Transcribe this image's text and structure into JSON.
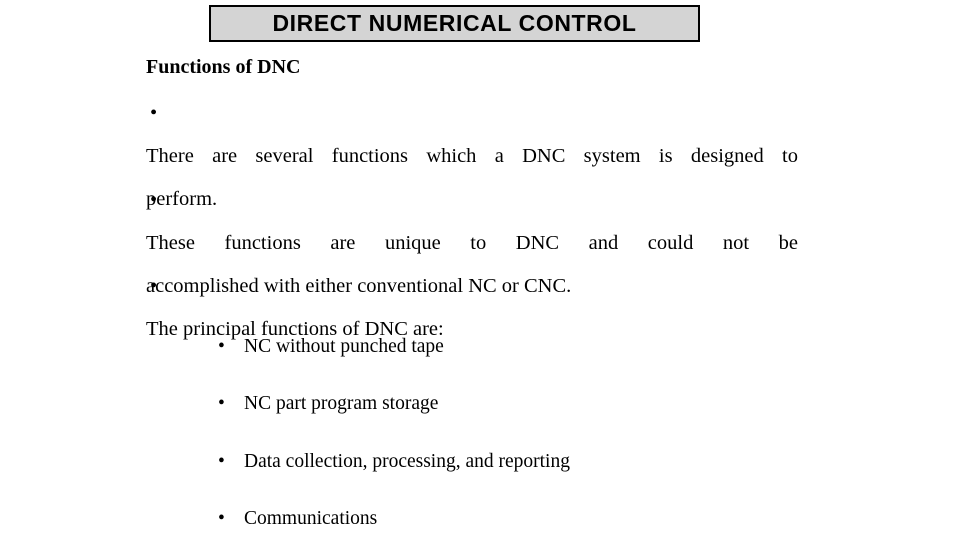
{
  "slide": {
    "background_color": "#ffffff",
    "text_color": "#000000",
    "title_box_fill": "#d4d4d4",
    "title_box_border": "#000000",
    "title": "DIRECT NUMERICAL CONTROL",
    "subheading": "Functions of DNC",
    "bullet_marker": "•",
    "bullets": [
      {
        "marker": "•",
        "justified": true,
        "lines": [
          "There are several functions which a DNC system is designed to",
          "perform."
        ]
      },
      {
        "marker": "•",
        "justified": true,
        "lines": [
          "These functions are unique to DNC and could not be",
          "accomplished with either conventional NC or CNC."
        ]
      },
      {
        "marker": "•",
        "justified": false,
        "lines": [
          "The principal functions of DNC are:"
        ]
      }
    ],
    "sub_bullets": [
      {
        "marker": "•",
        "text": "NC without punched tape"
      },
      {
        "marker": "•",
        "text": "NC part program storage"
      },
      {
        "marker": "•",
        "text": "Data collection, processing, and reporting"
      },
      {
        "marker": "•",
        "text": "Communications"
      }
    ]
  }
}
